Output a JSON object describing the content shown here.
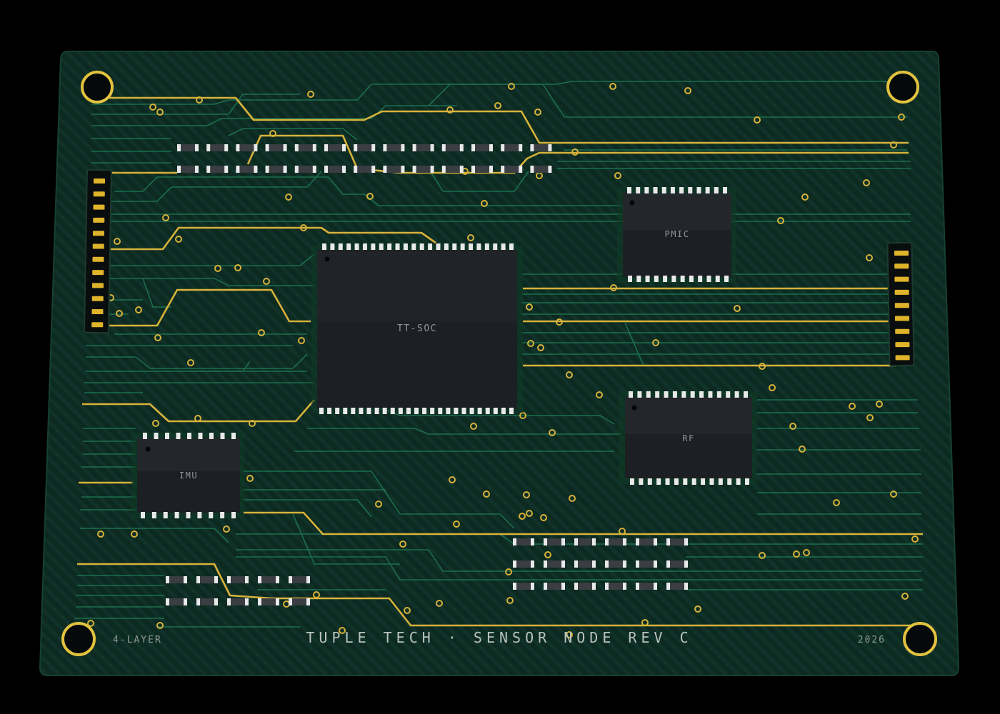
{
  "board": {
    "title": "TUPLE TECH · SENSOR NODE REV C",
    "layers": "4-LAYER",
    "year": "2026"
  },
  "chips": {
    "soc": {
      "label": "TT-SOC"
    },
    "pmic": {
      "label": "PMIC"
    },
    "rf": {
      "label": "RF"
    },
    "imu": {
      "label": "IMU"
    }
  },
  "colors": {
    "background": "#000000",
    "board": "#0d2a20",
    "board_stripe": "#11352a",
    "trace_green": "#1f7a55",
    "trace_gold": "#d8b23a",
    "chip": "#1c1f23",
    "chip_top": "#24282d",
    "pin": "#e9e9e9",
    "silkscreen": "#a9b5af"
  }
}
